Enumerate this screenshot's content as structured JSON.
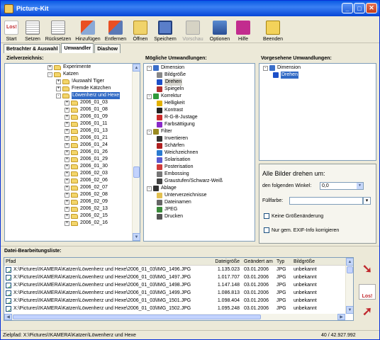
{
  "window": {
    "title": "Picture-Kit"
  },
  "toolbar": [
    {
      "label": "Start",
      "icon": "start-icon",
      "disabled": false
    },
    {
      "label": "Setzen",
      "icon": "set-icon",
      "disabled": false
    },
    {
      "label": "Rücksetzen",
      "icon": "reset-icon",
      "disabled": false
    },
    {
      "label": "Hinzufügen",
      "icon": "add-icon",
      "disabled": false
    },
    {
      "label": "Entfernen",
      "icon": "remove-icon",
      "disabled": false
    },
    {
      "label": "Öffnen",
      "icon": "folder-open-icon",
      "disabled": false
    },
    {
      "label": "Speichern",
      "icon": "save-icon",
      "disabled": false
    },
    {
      "label": "Vorschau",
      "icon": "preview-icon",
      "disabled": true
    },
    {
      "label": "Optionen",
      "icon": "options-icon",
      "disabled": false
    },
    {
      "label": "Hilfe",
      "icon": "help-icon",
      "disabled": false
    },
    {
      "label": "Beenden",
      "icon": "exit-icon",
      "disabled": false
    }
  ],
  "tabs": [
    "Betrachter & Auswahl",
    "Umwandler",
    "Diashow"
  ],
  "folders": {
    "header": "Zielverzeichnis:",
    "items": [
      {
        "label": "Experimente",
        "indent": 0,
        "expand": "+"
      },
      {
        "label": "Katzen",
        "indent": 0,
        "expand": "-"
      },
      {
        "label": "!Auswahl Tiger",
        "indent": 1,
        "expand": "+"
      },
      {
        "label": "Fremde Kätzchen",
        "indent": 1,
        "expand": "+"
      },
      {
        "label": "Löwenherz und Hexe",
        "indent": 1,
        "expand": "-",
        "selected": true
      },
      {
        "label": "2006_01_03",
        "indent": 2,
        "expand": "+"
      },
      {
        "label": "2006_01_08",
        "indent": 2,
        "expand": "+"
      },
      {
        "label": "2006_01_09",
        "indent": 2,
        "expand": "+"
      },
      {
        "label": "2006_01_11",
        "indent": 2,
        "expand": "+"
      },
      {
        "label": "2006_01_13",
        "indent": 2,
        "expand": "+"
      },
      {
        "label": "2006_01_21",
        "indent": 2,
        "expand": "+"
      },
      {
        "label": "2006_01_24",
        "indent": 2,
        "expand": "+"
      },
      {
        "label": "2006_01_26",
        "indent": 2,
        "expand": "+"
      },
      {
        "label": "2006_01_29",
        "indent": 2,
        "expand": "+"
      },
      {
        "label": "2006_01_30",
        "indent": 2,
        "expand": "+"
      },
      {
        "label": "2006_02_03",
        "indent": 2,
        "expand": "+"
      },
      {
        "label": "2006_02_06",
        "indent": 2,
        "expand": "+"
      },
      {
        "label": "2006_02_07",
        "indent": 2,
        "expand": "+"
      },
      {
        "label": "2006_02_08",
        "indent": 2,
        "expand": "+"
      },
      {
        "label": "2006_02_09",
        "indent": 2,
        "expand": "+"
      },
      {
        "label": "2006_02_13",
        "indent": 2,
        "expand": "+"
      },
      {
        "label": "2006_02_15",
        "indent": 2,
        "expand": "+"
      },
      {
        "label": "2006_02_16",
        "indent": 2,
        "expand": "+"
      }
    ]
  },
  "possible": {
    "header": "Mögliche Umwandlungen:",
    "items": [
      {
        "label": "Dimension",
        "indent": 0,
        "expand": "-",
        "icon": "ruler-icon",
        "color": "#3a6ec9"
      },
      {
        "label": "Bildgröße",
        "indent": 1,
        "icon": "resize-icon",
        "color": "#888888"
      },
      {
        "label": "Drehen",
        "indent": 1,
        "icon": "rotate-icon",
        "color": "#1c4fc8",
        "highlight": true
      },
      {
        "label": "Spiegeln",
        "indent": 1,
        "icon": "mirror-icon",
        "color": "#b03030"
      },
      {
        "label": "Korrektur",
        "indent": 0,
        "expand": "-",
        "icon": "correction-icon",
        "color": "#2e9a3a"
      },
      {
        "label": "Helligkeit",
        "indent": 1,
        "icon": "brightness-icon",
        "color": "#e2b000"
      },
      {
        "label": "Kontrast",
        "indent": 1,
        "icon": "contrast-icon",
        "color": "#222222"
      },
      {
        "label": "R-G-B-Justage",
        "indent": 1,
        "icon": "rgb-icon",
        "color": "#cc2a2a"
      },
      {
        "label": "Farbsättigung",
        "indent": 1,
        "icon": "saturation-icon",
        "color": "#8a2ac8"
      },
      {
        "label": "Filter",
        "indent": 0,
        "expand": "-",
        "icon": "filter-icon",
        "color": "#9a8a20"
      },
      {
        "label": "Invertieren",
        "indent": 1,
        "icon": "invert-icon",
        "color": "#333333"
      },
      {
        "label": "Schärfen",
        "indent": 1,
        "icon": "sharpen-icon",
        "color": "#b02020"
      },
      {
        "label": "Weichzeichnen",
        "indent": 1,
        "icon": "blur-icon",
        "color": "#2a7ad0"
      },
      {
        "label": "Solarisation",
        "indent": 1,
        "icon": "solarize-icon",
        "color": "#5a5ad0"
      },
      {
        "label": "Posterisation",
        "indent": 1,
        "icon": "posterize-icon",
        "color": "#d03a3a"
      },
      {
        "label": "Embossing",
        "indent": 1,
        "icon": "emboss-icon",
        "color": "#777777"
      },
      {
        "label": "Graustufen/Schwarz-Weiß",
        "indent": 1,
        "icon": "grayscale-icon",
        "color": "#444444"
      },
      {
        "label": "Ablage",
        "indent": 0,
        "expand": "-",
        "icon": "storage-icon",
        "color": "#333333"
      },
      {
        "label": "Unterverzeichnisse",
        "indent": 1,
        "icon": "subfolder-icon",
        "color": "#e2c050"
      },
      {
        "label": "Dateinamen",
        "indent": 1,
        "icon": "filename-icon",
        "color": "#666666"
      },
      {
        "label": "JPEG",
        "indent": 1,
        "icon": "jpeg-icon",
        "color": "#3a8a3a"
      },
      {
        "label": "Drucken",
        "indent": 1,
        "icon": "print-icon",
        "color": "#555555"
      }
    ]
  },
  "planned": {
    "header": "Vorgesehene Umwandlungen:",
    "items": [
      {
        "label": "Dimension",
        "indent": 0,
        "expand": "-",
        "icon": "ruler-icon",
        "color": "#3a6ec9"
      },
      {
        "label": "Drehen",
        "indent": 1,
        "icon": "rotate-icon",
        "color": "#1c4fc8",
        "selected": true
      }
    ]
  },
  "rotate": {
    "heading": "Alle Bilder drehen um:",
    "angle_label": "den folgenden Winkel:",
    "angle_value": "0,0",
    "fill_label": "Füllfarbe:",
    "fill_value": "",
    "no_resize_label": "Keine Größenänderung",
    "no_resize_checked": false,
    "exif_label": "Nur gem. EXIF-Info korrigieren",
    "exif_checked": false
  },
  "filelist": {
    "header": "Datei-Bearbeitungsliste:",
    "columns": [
      "Pfad",
      "Dateigröße",
      "Geändert am",
      "Typ",
      "Bildgröße"
    ],
    "rows": [
      [
        "X:\\Pictures\\!KAMERA\\Katzen\\Löwenherz und Hexe\\2006_01_03\\IMG_1496.JPG",
        "1.135.023",
        "03.01.2006",
        "JPG",
        "unbekannt"
      ],
      [
        "X:\\Pictures\\!KAMERA\\Katzen\\Löwenherz und Hexe\\2006_01_03\\IMG_1497.JPG",
        "1.017.707",
        "03.01.2006",
        "JPG",
        "unbekannt"
      ],
      [
        "X:\\Pictures\\!KAMERA\\Katzen\\Löwenherz und Hexe\\2006_01_03\\IMG_1498.JPG",
        "1.147.148",
        "03.01.2006",
        "JPG",
        "unbekannt"
      ],
      [
        "X:\\Pictures\\!KAMERA\\Katzen\\Löwenherz und Hexe\\2006_01_03\\IMG_1499.JPG",
        "1.086.813",
        "03.01.2006",
        "JPG",
        "unbekannt"
      ],
      [
        "X:\\Pictures\\!KAMERA\\Katzen\\Löwenherz und Hexe\\2006_01_03\\IMG_1501.JPG",
        "1.098.404",
        "03.01.2006",
        "JPG",
        "unbekannt"
      ],
      [
        "X:\\Pictures\\!KAMERA\\Katzen\\Löwenherz und Hexe\\2006_01_03\\IMG_1502.JPG",
        "1.095.248",
        "03.01.2006",
        "JPG",
        "unbekannt"
      ]
    ]
  },
  "side_buttons": [
    {
      "icon": "arrow-right-icon",
      "color": "#c0282d"
    },
    {
      "icon": "start-icon",
      "color": "#c0282d",
      "label": "Los!"
    },
    {
      "icon": "arrow-left-icon",
      "color": "#c0282d"
    }
  ],
  "start_icon_text": "Los!",
  "status": {
    "path": "Zielpfad: X:\\Pictures\\!KAMERA\\Katzen\\Löwenherz und Hexe",
    "count": "40 / 42.927.992"
  }
}
